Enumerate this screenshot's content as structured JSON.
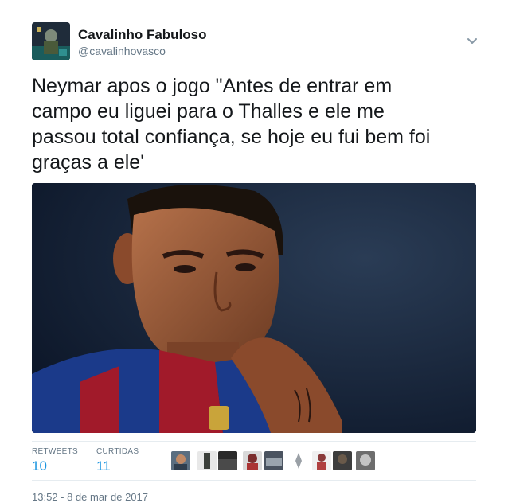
{
  "user": {
    "display_name": "Cavalinho Fabuloso",
    "handle": "@cavalinhovasco",
    "avatar_icon": "user-avatar-icon"
  },
  "tweet": {
    "lines": [
      "Neymar apos o jogo \"Antes de entrar em",
      "campo eu liguei para o Thalles e ele me",
      "passou total confiança, se hoje eu fui bem foi",
      "graças a ele'"
    ],
    "media_icon": "photo-football-player"
  },
  "stats": {
    "retweets_label": "RETWEETS",
    "retweets_value": "10",
    "likes_label": "CURTIDAS",
    "likes_value": "11"
  },
  "likers": [
    {
      "icon": "liker-avatar-icon",
      "color": "#5a6e80"
    },
    {
      "icon": "liker-avatar-icon",
      "color": "#3b3f3a"
    },
    {
      "icon": "liker-avatar-icon",
      "color": "#2a2a2a"
    },
    {
      "icon": "liker-avatar-icon",
      "color": "#7b2d2d"
    },
    {
      "icon": "liker-avatar-icon",
      "color": "#4a5360"
    },
    {
      "icon": "liker-avatar-icon",
      "color": "#9aa0a6"
    },
    {
      "icon": "liker-avatar-icon",
      "color": "#8a3a3a"
    },
    {
      "icon": "liker-avatar-icon",
      "color": "#3d3d3d"
    },
    {
      "icon": "liker-avatar-icon",
      "color": "#6d6d6d"
    }
  ],
  "timestamp": "13:52 - 8 de mar de 2017",
  "colors": {
    "link_blue": "#1b95e0",
    "muted": "#657786",
    "divider": "#e6ecf0"
  },
  "menu_icon": "chevron-down-icon"
}
